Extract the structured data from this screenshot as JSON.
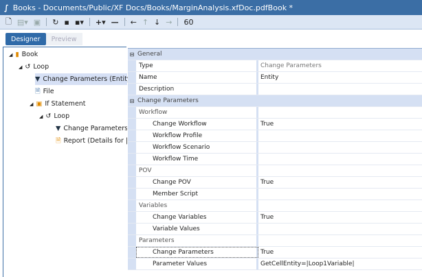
{
  "window": {
    "title": "Books - Documents/Public/XF Docs/Books/MarginAnalysis.xfDoc.pdfBook *"
  },
  "toolbar": {
    "icons": [
      "new-icon",
      "open-icon",
      "window-icon",
      "refresh-icon",
      "save-icon",
      "save-as-icon",
      "add-icon",
      "remove-icon",
      "arrow-left-icon",
      "arrow-up-icon",
      "arrow-down-icon",
      "arrow-right-icon",
      "find-icon"
    ]
  },
  "tabs": [
    {
      "label": "Designer",
      "active": true
    },
    {
      "label": "Preview",
      "active": false
    }
  ],
  "tree": [
    {
      "label": "Book",
      "level": 0
    },
    {
      "label": "Loop",
      "level": 1
    },
    {
      "label": "Change Parameters (Entity)",
      "level": 2,
      "selected": true
    },
    {
      "label": "File",
      "level": 2
    },
    {
      "label": "If Statement",
      "level": 2
    },
    {
      "label": "Loop",
      "level": 3
    },
    {
      "label": "Change Parameters (P",
      "level": 4
    },
    {
      "label": "Report (Details for |!Pr",
      "level": 4
    }
  ],
  "grid": [
    {
      "kind": "cat",
      "name": "General",
      "value": ""
    },
    {
      "kind": "prop",
      "name": "Type",
      "value": "Change Parameters",
      "gray": true
    },
    {
      "kind": "prop",
      "name": "Name",
      "value": "Entity"
    },
    {
      "kind": "prop",
      "name": "Description",
      "value": ""
    },
    {
      "kind": "cat",
      "name": "Change Parameters",
      "value": ""
    },
    {
      "kind": "sub",
      "name": "Workflow",
      "value": ""
    },
    {
      "kind": "prop2",
      "name": "Change Workflow",
      "value": "True"
    },
    {
      "kind": "prop2",
      "name": "Workflow Profile",
      "value": ""
    },
    {
      "kind": "prop2",
      "name": "Workflow Scenario",
      "value": ""
    },
    {
      "kind": "prop2",
      "name": "Workflow Time",
      "value": ""
    },
    {
      "kind": "sub",
      "name": "POV",
      "value": ""
    },
    {
      "kind": "prop2",
      "name": "Change POV",
      "value": "True"
    },
    {
      "kind": "prop2",
      "name": "Member Script",
      "value": ""
    },
    {
      "kind": "sub",
      "name": "Variables",
      "value": ""
    },
    {
      "kind": "prop2",
      "name": "Change Variables",
      "value": "True"
    },
    {
      "kind": "prop2",
      "name": "Variable Values",
      "value": ""
    },
    {
      "kind": "sub",
      "name": "Parameters",
      "value": ""
    },
    {
      "kind": "prop2",
      "name": "Change Parameters",
      "value": "True",
      "focus": true
    },
    {
      "kind": "prop2",
      "name": "Parameter Values",
      "value": "GetCellEntity=|Loop1Variable|"
    }
  ]
}
